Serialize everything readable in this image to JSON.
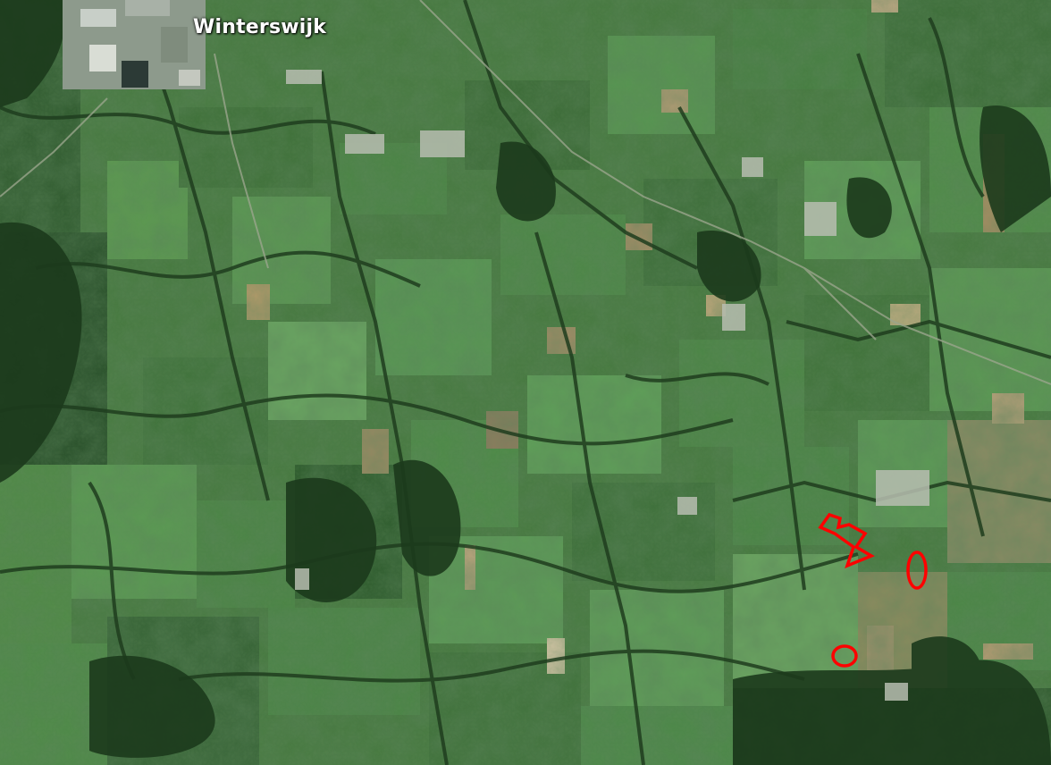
{
  "map": {
    "type": "satellite",
    "place_label": "Winterswijk",
    "marker_color": "#ff0000",
    "markers": [
      {
        "kind": "polygon-outline",
        "name": "marked-parcel"
      },
      {
        "kind": "ellipse",
        "name": "marked-ellipse"
      },
      {
        "kind": "circle",
        "name": "marked-circle"
      }
    ]
  }
}
